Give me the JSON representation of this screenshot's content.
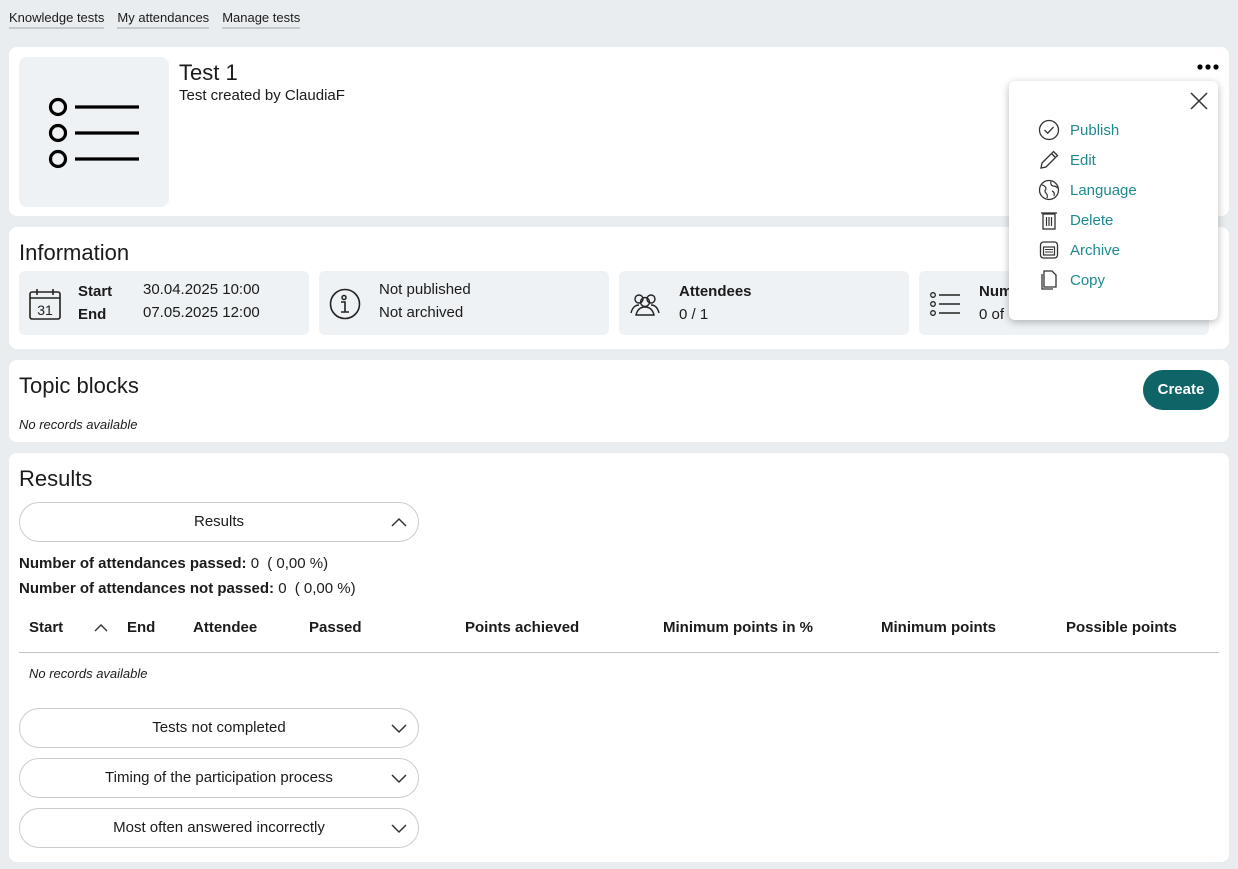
{
  "nav": {
    "tabs": [
      "Knowledge tests",
      "My attendances",
      "Manage tests"
    ]
  },
  "test": {
    "title": "Test 1",
    "subtitle": "Test created by ClaudiaF",
    "icon": "list-icon"
  },
  "info": {
    "heading": "Information",
    "start_label": "Start",
    "start_value": "30.04.2025 10:00",
    "end_label": "End",
    "end_value": "07.05.2025 12:00",
    "published": "Not published",
    "archived": "Not archived",
    "attendees_label": "Attendees",
    "attendees_value": "0 / 1",
    "questions_label": "Num",
    "questions_value": "0 of"
  },
  "topics": {
    "heading": "Topic blocks",
    "empty": "No records available",
    "create_label": "Create"
  },
  "results": {
    "heading": "Results",
    "accordion_label": "Results",
    "passed_label": "Number of attendances passed:",
    "passed_value": "0",
    "passed_pct": "( 0,00 %)",
    "not_passed_label": "Number of attendances not passed:",
    "not_passed_value": "0",
    "not_passed_pct": "( 0,00 %)",
    "columns": [
      "Start",
      "End",
      "Attendee",
      "Passed",
      "Points achieved",
      "Minimum points in %",
      "Minimum points",
      "Possible points"
    ],
    "empty": "No records available",
    "sections": [
      "Tests not completed",
      "Timing of the participation process",
      "Most often answered incorrectly"
    ]
  },
  "menu": {
    "items": [
      {
        "label": "Publish",
        "icon": "check-circle-icon"
      },
      {
        "label": "Edit",
        "icon": "pencil-icon"
      },
      {
        "label": "Language",
        "icon": "globe-icon"
      },
      {
        "label": "Delete",
        "icon": "trash-icon"
      },
      {
        "label": "Archive",
        "icon": "archive-box-icon"
      },
      {
        "label": "Copy",
        "icon": "copy-icon"
      }
    ]
  },
  "colors": {
    "accent": "#0f6467",
    "link": "#1e8a8f",
    "background": "#e9edef",
    "tile": "#eef2f4"
  }
}
